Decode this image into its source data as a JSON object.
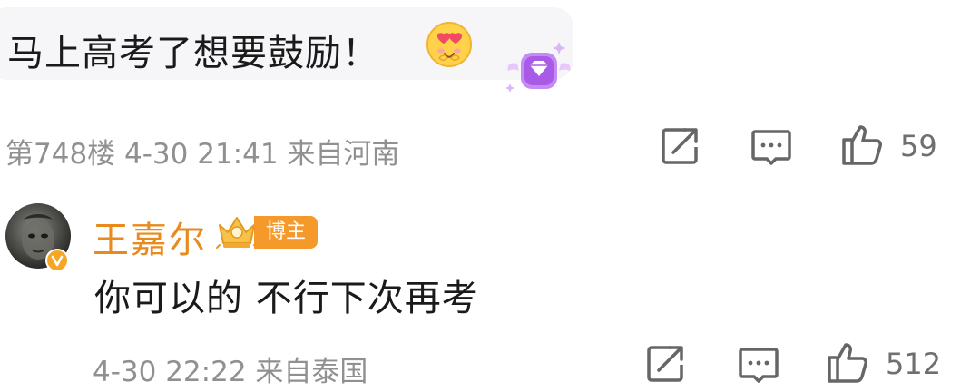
{
  "comment": {
    "text": "马上高考了想要鼓励！",
    "emoji": "heart-eyes-emoji",
    "badge": "diamond-badge-icon",
    "floor_meta": "第748楼 4-30 21:41 来自河南",
    "likes": "59"
  },
  "reply": {
    "user_name": "王嘉尔",
    "author_tag": "博主",
    "text": "你可以的 不行下次再考",
    "meta": "4-30 22:22 来自泰国",
    "likes": "512"
  },
  "icons": {
    "repost": "repost-icon",
    "comment": "comment-icon",
    "like": "thumbs-up-icon",
    "crown": "crown-badge-icon",
    "verified": "verified-badge-icon"
  },
  "colors": {
    "username": "#e98a1d",
    "tag_bg": "#f59a2a",
    "meta": "#909090",
    "bubble_bg": "#f6f6f8",
    "badge_purple": "#b76cf2"
  }
}
